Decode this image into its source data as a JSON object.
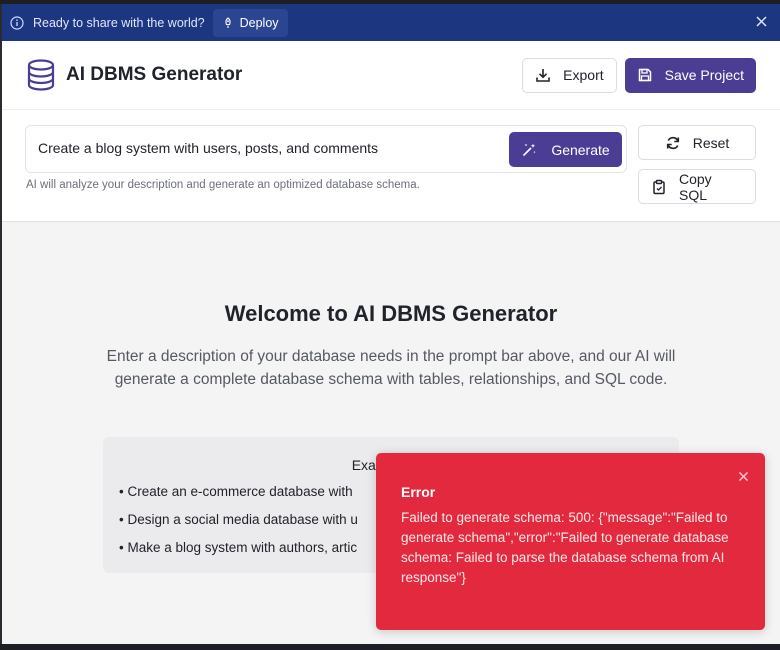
{
  "banner": {
    "text": "Ready to share with the world?",
    "deploy_label": "Deploy"
  },
  "header": {
    "title": "AI DBMS Generator",
    "export_label": "Export",
    "save_label": "Save Project"
  },
  "prompt": {
    "value": "Create a blog system with users, posts, and comments",
    "generate_label": "Generate",
    "hint": "AI will analyze your description and generate an optimized database schema.",
    "reset_label": "Reset",
    "copy_label": "Copy SQL"
  },
  "welcome": {
    "title": "Welcome to AI DBMS Generator",
    "description": "Enter a description of your database needs in the prompt bar above, and our AI will generate a complete database schema with tables, relationships, and SQL code.",
    "examples_title": "Example pro",
    "examples": [
      "• Create an e-commerce database with",
      "• Design a social media database with u",
      "• Make a blog system with authors, artic"
    ]
  },
  "toast": {
    "title": "Error",
    "message": "Failed to generate schema: 500: {\"message\":\"Failed to generate schema\",\"error\":\"Failed to generate database schema: Failed to parse the database schema from AI response\"}"
  },
  "colors": {
    "banner": "#1d3680",
    "accent": "#4b3d94",
    "error": "#e2293e",
    "main_bg": "#f4f4f5"
  },
  "icons": [
    "info-icon",
    "rocket-icon",
    "close-icon",
    "database-icon",
    "download-icon",
    "save-icon",
    "magic-wand-icon",
    "refresh-icon",
    "clipboard-icon"
  ]
}
